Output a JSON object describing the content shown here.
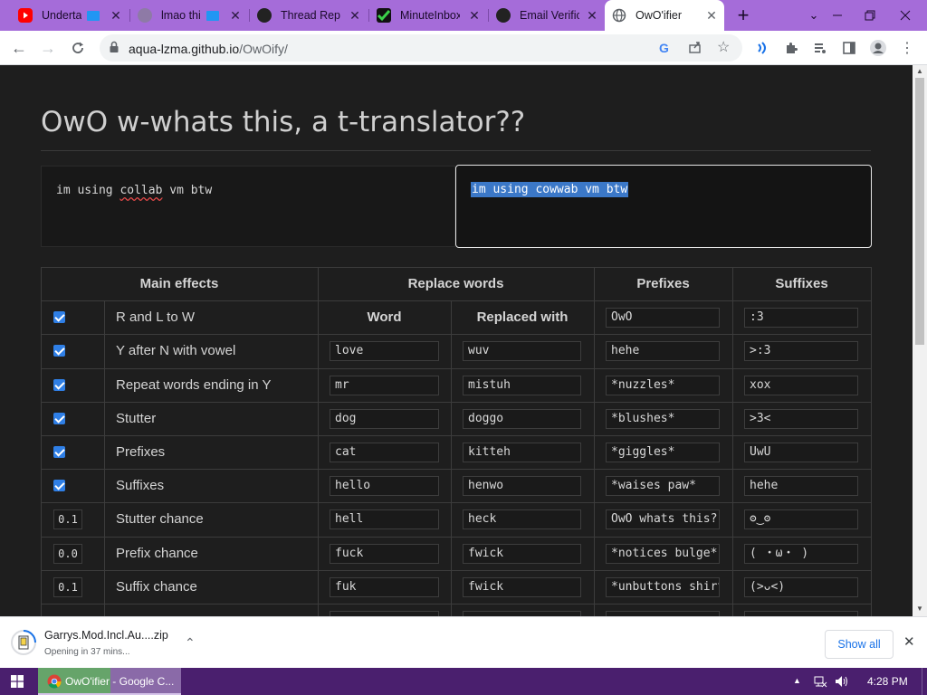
{
  "browser": {
    "tabs": [
      {
        "title": "Undertale",
        "favicon": "youtube-icon",
        "color": "#ff0000",
        "active": false
      },
      {
        "title": "lmao this",
        "favicon": "vm-icon",
        "color": "#8e7aa6",
        "active": false
      },
      {
        "title": "Thread Replies",
        "favicon": "thread-icon",
        "color": "#222222",
        "active": false
      },
      {
        "title": "MinuteInbox",
        "favicon": "minuteinbox-icon",
        "color": "#3bb54a",
        "active": false
      },
      {
        "title": "Email Verification",
        "favicon": "email-icon",
        "color": "#222222",
        "active": false
      },
      {
        "title": "OwO'ifier",
        "favicon": "globe-icon",
        "color": "#5f6368",
        "active": true
      }
    ],
    "new_tab_label": "+",
    "url_host": "aqua-lzma.github.io",
    "url_path": "/OwOify/",
    "accent": "#a56cd9"
  },
  "page": {
    "heading": "OwO w-whats this, a t-translator??",
    "input_text": "im using collab vm btw",
    "input_misspelled": "collab",
    "output_text": "im using cowwab vm btw",
    "table": {
      "headers": {
        "main_effects": "Main effects",
        "replace_words": "Replace words",
        "prefixes": "Prefixes",
        "suffixes": "Suffixes",
        "word": "Word",
        "replaced_with": "Replaced with"
      },
      "effects": [
        {
          "label": "R and L to W",
          "checked": true
        },
        {
          "label": "Y after N with vowel",
          "checked": true
        },
        {
          "label": "Repeat words ending in Y",
          "checked": true
        },
        {
          "label": "Stutter",
          "checked": true
        },
        {
          "label": "Prefixes",
          "checked": true
        },
        {
          "label": "Suffixes",
          "checked": true
        },
        {
          "label": "Stutter chance",
          "value": "0.1"
        },
        {
          "label": "Prefix chance",
          "value": "0.0"
        },
        {
          "label": "Suffix chance",
          "value": "0.1"
        }
      ],
      "replace_words": [
        {
          "word": "love",
          "replacement": "wuv"
        },
        {
          "word": "mr",
          "replacement": "mistuh"
        },
        {
          "word": "dog",
          "replacement": "doggo"
        },
        {
          "word": "cat",
          "replacement": "kitteh"
        },
        {
          "word": "hello",
          "replacement": "henwo"
        },
        {
          "word": "hell",
          "replacement": "heck"
        },
        {
          "word": "fuck",
          "replacement": "fwick"
        },
        {
          "word": "fuk",
          "replacement": "fwick"
        }
      ],
      "prefixes": [
        "OwO",
        "hehe",
        "*nuzzles*",
        "*blushes*",
        "*giggles*",
        "*waises paw*",
        "OwO whats this?",
        "*notices bulge*",
        "*unbuttons shirt"
      ],
      "suffixes": [
        ":3",
        ">:3",
        "xox",
        ">3<",
        "UwU",
        "hehe",
        "ʘ‿ʘ",
        "( ・ω・ )",
        "(>ᴗ<)"
      ]
    }
  },
  "download": {
    "filename": "Garrys.Mod.Incl.Au....zip",
    "status": "Opening in 37 mins...",
    "show_all": "Show all"
  },
  "taskbar": {
    "app_label": "OwO'ifier - Google C...",
    "time": "4:28 PM",
    "color": "#4a1f6e"
  }
}
